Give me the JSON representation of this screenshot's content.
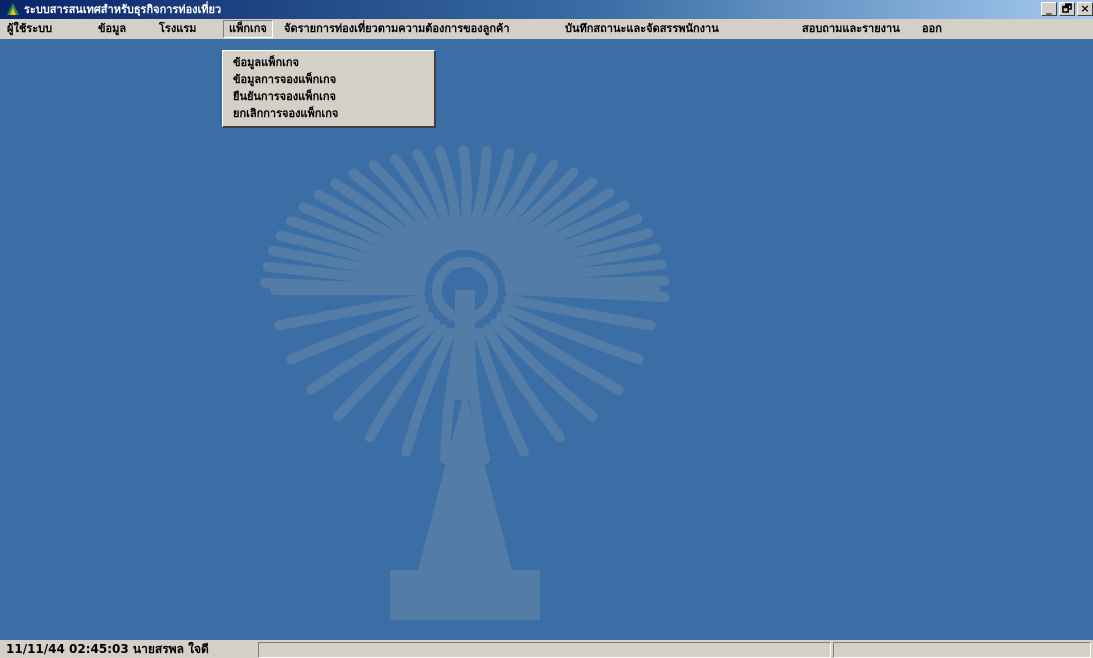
{
  "window": {
    "title": "ระบบสารสนเทศสำหรับธุรกิจการท่องเที่ยว",
    "buttons": {
      "minimize": "_",
      "restore": "🗗",
      "close": "×"
    }
  },
  "menu": {
    "items": [
      "ผู้ใช้ระบบ",
      "ข้อมูล",
      "โรงแรม",
      "แพ็กเกจ",
      "จัดรายการท่องเที่ยวตามความต้องการของลูกค้า",
      "บันทึกสถานะและจัดสรรพนักงาน",
      "สอบถามและรายงาน",
      "ออก"
    ],
    "active_index": 3
  },
  "dropdown": {
    "items": [
      "ข้อมูลแพ็กเกจ",
      "ข้อมูลการจองแพ็กเกจ",
      "ยืนยันการจองแพ็กเกจ",
      "ยกเลิกการจองแพ็กเกจ"
    ]
  },
  "statusbar": {
    "pane1": "11/11/44 02:45:03 นายสรพล ใจดี",
    "pane2": "",
    "pane3": ""
  },
  "colors": {
    "desktop": "#3b6ea5",
    "face": "#d4d0c8"
  },
  "icons": {
    "app": "app-icon",
    "watermark": "university-emblem"
  }
}
